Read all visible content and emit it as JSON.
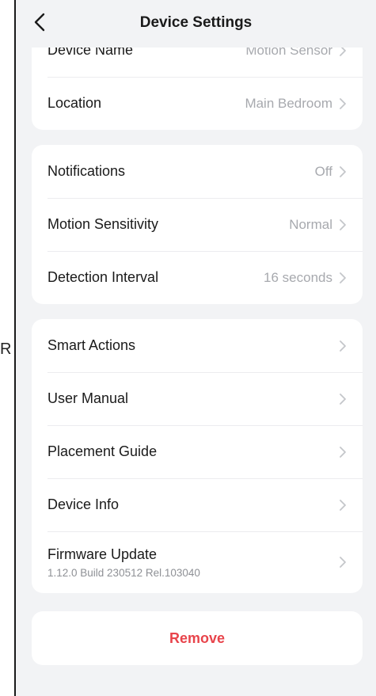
{
  "stray_char": "R",
  "header": {
    "title": "Device Settings",
    "back_icon": "chevron-left-icon"
  },
  "group1": [
    {
      "label": "Device Name",
      "value": "Motion Sensor"
    },
    {
      "label": "Location",
      "value": "Main Bedroom"
    }
  ],
  "group2": [
    {
      "label": "Notifications",
      "value": "Off"
    },
    {
      "label": "Motion Sensitivity",
      "value": "Normal"
    },
    {
      "label": "Detection Interval",
      "value": "16 seconds"
    }
  ],
  "group3": [
    {
      "label": "Smart Actions"
    },
    {
      "label": "User Manual"
    },
    {
      "label": "Placement Guide"
    },
    {
      "label": "Device Info"
    },
    {
      "label": "Firmware Update",
      "sublabel": "1.12.0 Build 230512 Rel.103040"
    }
  ],
  "remove": {
    "label": "Remove"
  },
  "colors": {
    "background": "#f2f3f5",
    "card": "#ffffff",
    "value_text": "#a7a9ae",
    "danger": "#e8444b"
  }
}
